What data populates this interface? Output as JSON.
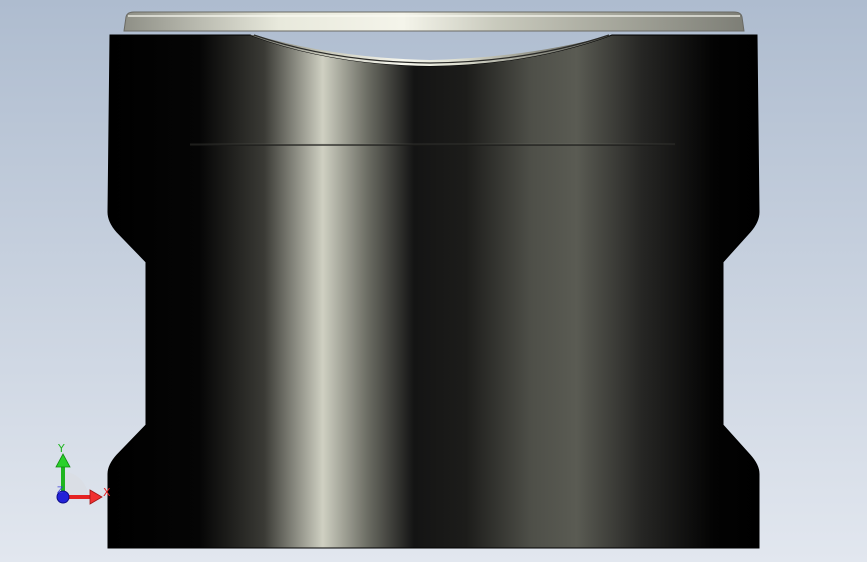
{
  "viewport": {
    "background_top": "#aebccf",
    "background_bottom": "#dfe5ee",
    "model": {
      "body_color": "#000000",
      "highlight_color": "#d8d9cc",
      "top_rim_color": "#c9c9bf",
      "seam_line_color": "#2a2a2a"
    }
  },
  "triad": {
    "x_label": "X",
    "y_label": "Y",
    "z_label": "Z",
    "x_color": "#e52222",
    "y_color": "#1fb51f",
    "z_color": "#2222d8"
  }
}
